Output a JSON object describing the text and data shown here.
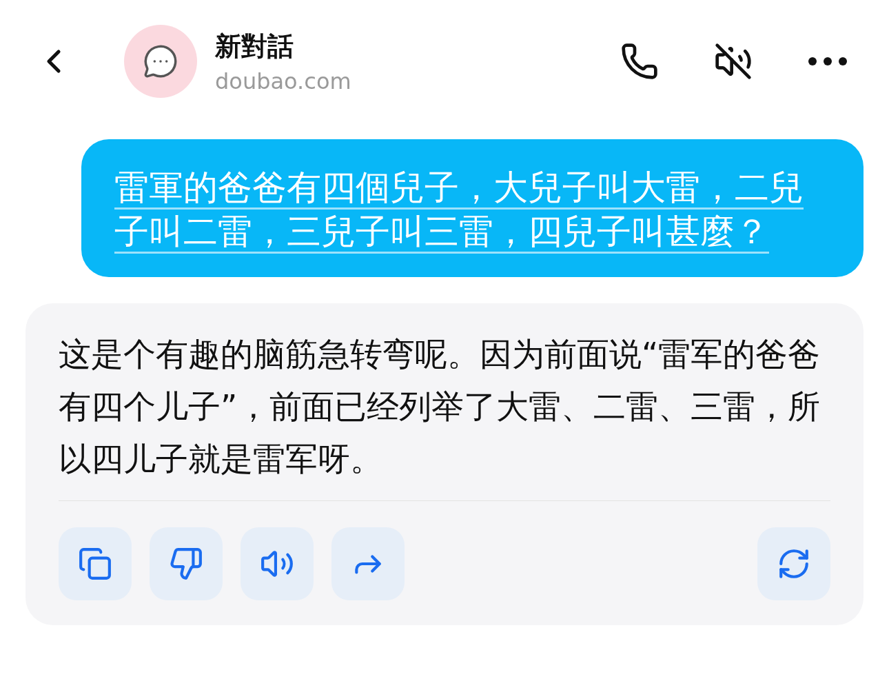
{
  "header": {
    "title": "新對話",
    "subtitle": "doubao.com"
  },
  "user_message": {
    "text": "雷軍的爸爸有四個兒子，大兒子叫大雷，二兒子叫二雷，三兒子叫三雷，四兒子叫甚麼？"
  },
  "reply": {
    "text": "这是个有趣的脑筋急转弯呢。因为前面说“雷军的爸爸有四个儿子”，前面已经列举了大雷、二雷、三雷，所以四儿子就是雷军呀。",
    "actions": [
      {
        "kind": "copy"
      },
      {
        "kind": "dislike"
      },
      {
        "kind": "speak"
      },
      {
        "kind": "share"
      },
      {
        "kind": "regenerate"
      }
    ]
  }
}
